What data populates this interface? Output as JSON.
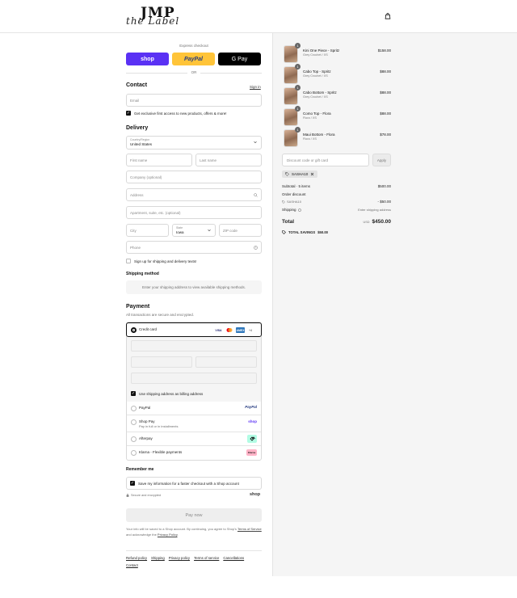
{
  "header": {
    "logo_main": "JMP",
    "logo_sub": "the Label",
    "bag_icon": "shopping-bag-icon"
  },
  "express": {
    "label": "Express checkout",
    "shop": "shop",
    "paypal": "PayPal",
    "gpay": "G Pay",
    "or": "OR"
  },
  "contact": {
    "title": "Contact",
    "signin": "Sign in",
    "email_placeholder": "Email",
    "news_opt": "Get exclusive first access to new products, offers & more!"
  },
  "delivery": {
    "title": "Delivery",
    "country_label": "Country/Region",
    "country_value": "United States",
    "first_name": "First name",
    "last_name": "Last name",
    "company": "Company (optional)",
    "address": "Address",
    "apartment": "Apartment, suite, etc. (optional)",
    "city": "City",
    "state_label": "State",
    "state_value": "Iowa",
    "zip": "ZIP code",
    "phone": "Phone",
    "sms_opt": "Sign up for shipping and delivery texts!"
  },
  "shipping_method": {
    "title": "Shipping method",
    "message": "Enter your shipping address to view available shipping methods."
  },
  "payment": {
    "title": "Payment",
    "subtitle": "All transactions are secure and encrypted.",
    "credit_card": "Credit card",
    "cards": [
      "VISA",
      "MC",
      "AMEX",
      "+4"
    ],
    "billing_same": "Use shipping address as billing address",
    "paypal": "PayPal",
    "paypal_logo": "PayPal",
    "shoppay": "Shop Pay",
    "shoppay_sub": "Pay in full or in installments",
    "shoppay_logo": "shop",
    "afterpay": "Afterpay",
    "klarna": "Klarna - Flexible payments",
    "klarna_logo": "Klarna"
  },
  "remember": {
    "title": "Remember me",
    "save_info": "Save my information for a faster checkout with a Shop account",
    "secure": "Secure and encrypted",
    "shop_logo": "shop"
  },
  "pay_now": "Pay now",
  "fine_print": {
    "pre": "Your info will be saved to a Shop account. By continuing, you agree to Shop's ",
    "terms": "Terms of Service",
    "mid": " and acknowledge the ",
    "privacy": "Privacy Policy",
    "end": "."
  },
  "footer": {
    "links": [
      "Refund policy",
      "Shipping",
      "Privacy policy",
      "Terms of service",
      "Cancellations",
      "Contact"
    ]
  },
  "summary": {
    "items": [
      {
        "name": "Kini One Piece - Spritz",
        "variant": "Grey Crochet / XS",
        "price": "$158.00",
        "qty": "1"
      },
      {
        "name": "Cabo Top - Spritz",
        "variant": "Grey Crochet / XS",
        "price": "$88.00",
        "qty": "1"
      },
      {
        "name": "Cabo Bottom - Spritz",
        "variant": "Grey Crochet / XS",
        "price": "$88.00",
        "qty": "1"
      },
      {
        "name": "Como Top - Flora",
        "variant": "Flora / XS",
        "price": "$88.00",
        "qty": "1"
      },
      {
        "name": "Maui Bottom - Flora",
        "variant": "Flora / XS",
        "price": "$78.00",
        "qty": "1"
      }
    ],
    "discount_placeholder": "Discount code or gift card",
    "apply": "Apply",
    "code": "SASHA10",
    "subtotal_label": "Subtotal · 5 items",
    "subtotal": "$500.00",
    "order_discount_label": "Order discount",
    "discount_code": "SASHA10",
    "discount_value": "- $50.00",
    "shipping_label": "Shipping",
    "shipping_value": "Enter shipping address",
    "total_label": "Total",
    "currency": "USD",
    "total": "$450.00",
    "savings_label": "TOTAL SAVINGS",
    "savings_value": "$50.00"
  }
}
